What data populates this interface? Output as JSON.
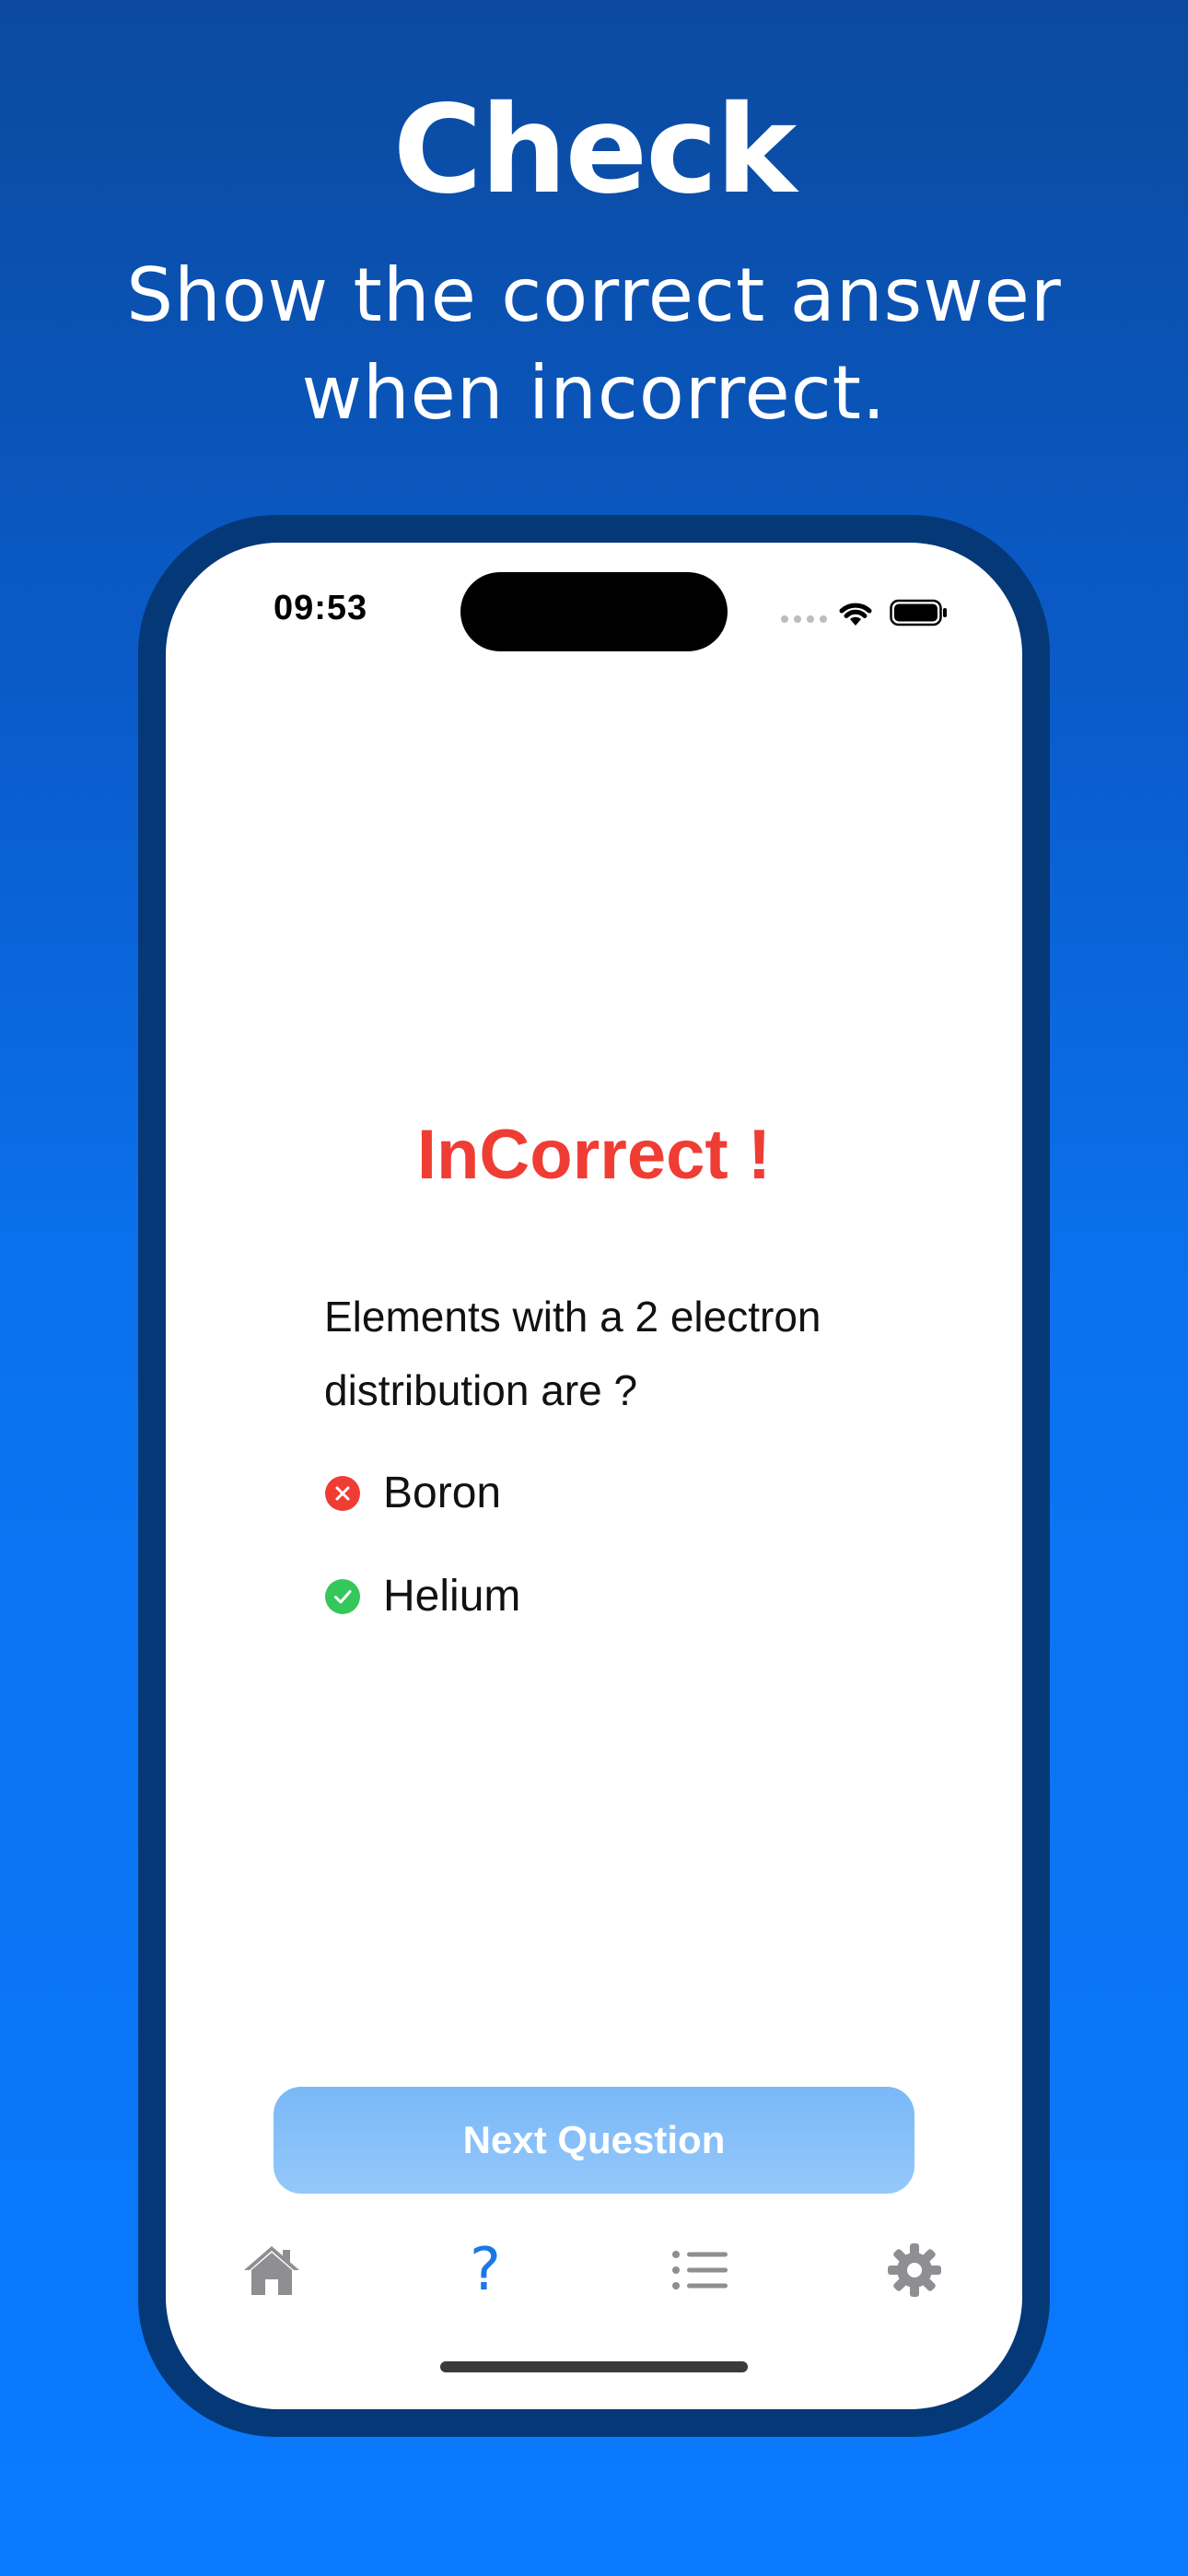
{
  "promo": {
    "title": "Check",
    "subtitle": "Show the correct answer when incorrect."
  },
  "status_bar": {
    "time": "09:53",
    "icons": [
      "cellular-signal-icon",
      "wifi-icon",
      "battery-icon"
    ]
  },
  "quiz": {
    "result": "InCorrect !",
    "question": "Elements with a 2 electron distribution are ?",
    "answers": [
      {
        "label": "Boron",
        "status": "incorrect",
        "icon": "x-circle-icon"
      },
      {
        "label": "Helium",
        "status": "correct",
        "icon": "check-circle-icon"
      }
    ],
    "next_button": "Next Question"
  },
  "tab_bar": {
    "items": [
      {
        "icon": "home-icon",
        "active": false
      },
      {
        "icon": "question-mark-icon",
        "glyph": "?",
        "active": true
      },
      {
        "icon": "list-icon",
        "active": false
      },
      {
        "icon": "gear-icon",
        "active": false
      }
    ]
  },
  "colors": {
    "background_top": "#0b4a9e",
    "background_bottom": "#0a7aff",
    "phone_frame": "#043877",
    "incorrect_red": "#ef3d33",
    "correct_green": "#34c759",
    "accent_blue": "#1a78e6",
    "button_blue": "#8cc2fa",
    "inactive_gray": "#8e8e93"
  }
}
